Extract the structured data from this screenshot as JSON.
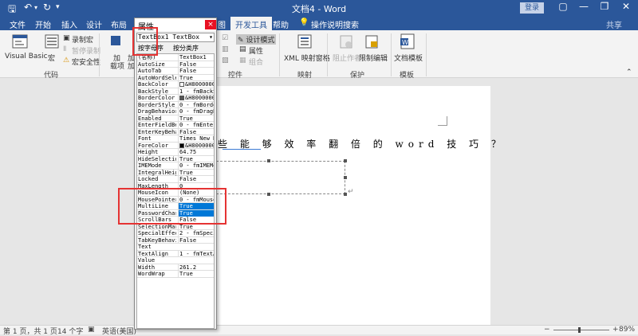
{
  "titlebar": {
    "doc_title": "文档4 - Word",
    "login": "登录",
    "minimize": "—",
    "restore": "❐",
    "close": "✕",
    "ribbon_toggle": "▢"
  },
  "tabs": [
    "文件",
    "开始",
    "插入",
    "设计",
    "布局",
    "图",
    "开发工具",
    "帮助",
    "操作说明搜索",
    "共享"
  ],
  "ribbon": {
    "code_group": {
      "visual_basic": "Visual Basic",
      "macro": "宏",
      "record_macro": "录制宏",
      "pause_record": "暂停录制",
      "macro_security": "宏安全性",
      "label": "代码"
    },
    "addin_group": {
      "addin1": "加",
      "addin1b": "载项",
      "addin2": "加",
      "addin2b": "加"
    },
    "controls_group": {
      "design_mode": "设计模式",
      "properties": "属性",
      "group": "组合",
      "label": "控件"
    },
    "mapping_group": {
      "xml_pane": "XML 映射窗格",
      "label": "映射"
    },
    "protect_group": {
      "block_authors": "阻止作者",
      "restrict_editing": "限制编辑",
      "label": "保护"
    },
    "template_group": {
      "doc_template": "文档模板",
      "label": "模板"
    }
  },
  "document": {
    "line1": "些 能 够 效 率 翻 倍 的  word  技 巧 ？"
  },
  "statusbar": {
    "page": "第 1 页，共 1 页",
    "words": "14 个字",
    "lang": "英语(美国)",
    "zoom": "89%",
    "minus": "−",
    "plus": "+"
  },
  "properties_panel": {
    "title": "属性",
    "close": "×",
    "object": "TextBox1 TextBox",
    "tab_alpha": "按字母序",
    "tab_cat": "按分类序",
    "rows": [
      {
        "name": "(名称)",
        "value": "TextBox1"
      },
      {
        "name": "AutoSize",
        "value": "False"
      },
      {
        "name": "AutoTab",
        "value": "False"
      },
      {
        "name": "AutoWordSelect",
        "value": "True"
      },
      {
        "name": "BackColor",
        "value": "&H80000005"
      },
      {
        "name": "BackStyle",
        "value": "1 - fmBackSt"
      },
      {
        "name": "BorderColor",
        "value": "&H80000006"
      },
      {
        "name": "BorderStyle",
        "value": "0 - fmBorder"
      },
      {
        "name": "DragBehavior",
        "value": "0 - fmDragBe"
      },
      {
        "name": "Enabled",
        "value": "True"
      },
      {
        "name": "EnterFieldBeh",
        "value": "0 - fmEnterF"
      },
      {
        "name": "EnterKeyBehav",
        "value": "False"
      },
      {
        "name": "Font",
        "value": "Times New Ro"
      },
      {
        "name": "ForeColor",
        "value": "&H80000008"
      },
      {
        "name": "Height",
        "value": "64.75"
      },
      {
        "name": "HideSelection",
        "value": "True"
      },
      {
        "name": "IMEMode",
        "value": "0 - fmIMEMod"
      },
      {
        "name": "IntegralHeigh",
        "value": "True"
      },
      {
        "name": "Locked",
        "value": "False"
      },
      {
        "name": "MaxLength",
        "value": "0"
      },
      {
        "name": "MouseIcon",
        "value": "(None)"
      },
      {
        "name": "MousePointer",
        "value": "0 - fmMouseP"
      },
      {
        "name": "MultiLine",
        "value": "True"
      },
      {
        "name": "PasswordChar",
        "value": "True"
      },
      {
        "name": "ScrollBars",
        "value": "False"
      },
      {
        "name": "SelectionMarg",
        "value": "True"
      },
      {
        "name": "SpecialEffect",
        "value": "2 - fmSpecia"
      },
      {
        "name": "TabKeyBehavio",
        "value": "False"
      },
      {
        "name": "Text",
        "value": ""
      },
      {
        "name": "TextAlign",
        "value": "1 - fmTextAl"
      },
      {
        "name": "Value",
        "value": ""
      },
      {
        "name": "Width",
        "value": "261.2"
      },
      {
        "name": "WordWrap",
        "value": "True"
      }
    ]
  },
  "colors": {
    "brand": "#2b579a",
    "highlight": "#e53333",
    "selection": "#0078d7"
  }
}
